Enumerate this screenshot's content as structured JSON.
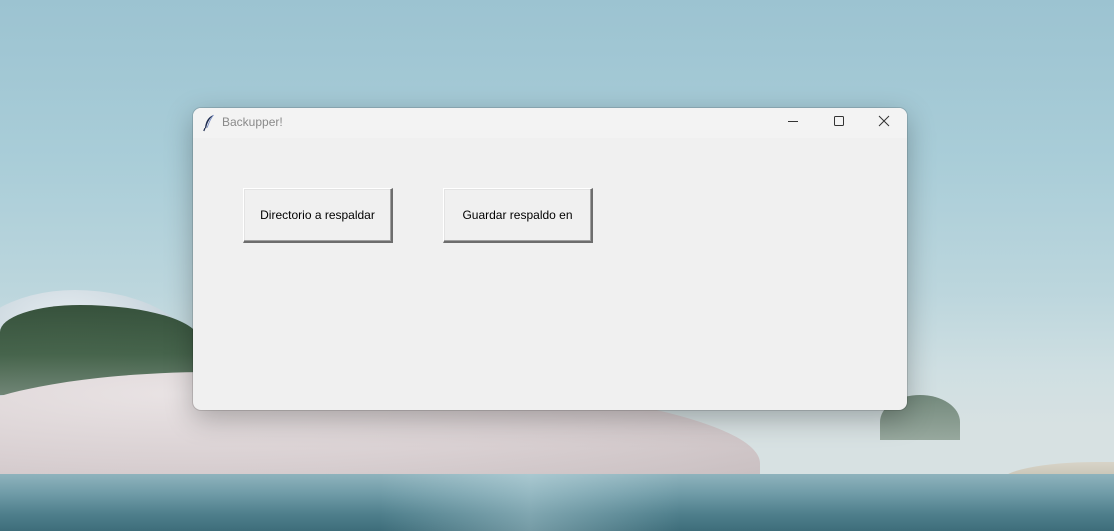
{
  "window": {
    "title": "Backupper!",
    "app_icon": "feather-icon",
    "controls": {
      "minimize_icon": "minimize-icon",
      "maximize_icon": "maximize-icon",
      "close_icon": "close-icon"
    }
  },
  "main": {
    "buttons": [
      {
        "label": "Directorio a respaldar"
      },
      {
        "label": "Guardar respaldo en"
      }
    ]
  },
  "colors": {
    "window_background": "#f0f0f0",
    "title_text": "#8a8a8a"
  }
}
